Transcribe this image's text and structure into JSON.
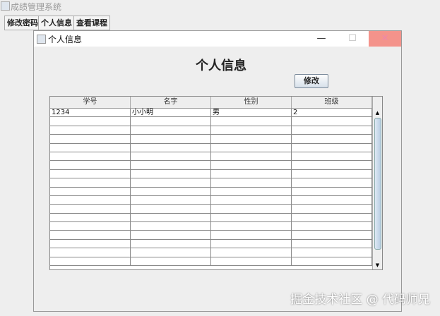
{
  "app": {
    "title": "成绩管理系统",
    "menu": [
      "修改密码",
      "个人信息",
      "查看课程"
    ]
  },
  "frame": {
    "title": "个人信息",
    "minimize": "—",
    "maximize": "☐",
    "close": "✕"
  },
  "main": {
    "heading": "个人信息",
    "edit_label": "修改"
  },
  "table": {
    "columns": [
      "学号",
      "名字",
      "性别",
      "班级"
    ],
    "rows": [
      [
        "1234",
        "小小明",
        "男",
        "2"
      ]
    ],
    "empty_rows": 17
  },
  "watermark": "掘金技术社区 @ 代码师兄"
}
